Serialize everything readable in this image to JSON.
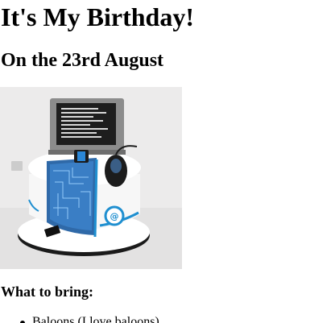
{
  "heading": "It's My Birthday!",
  "subheading": "On the 23rd August",
  "cake_image": {
    "alt": "Computer-themed birthday cake",
    "icon": "cake-image"
  },
  "bring_heading": "What to bring:",
  "bring_items": [
    "Baloons (I love baloons)"
  ],
  "colors": {
    "text": "#000000",
    "background": "#ffffff"
  }
}
